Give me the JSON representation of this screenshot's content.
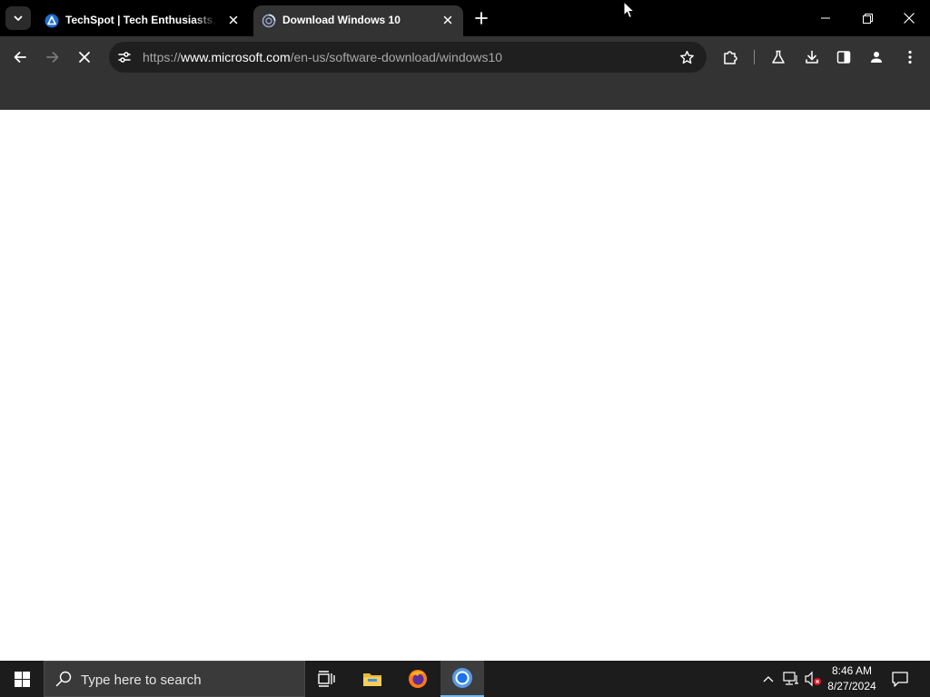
{
  "tabs": [
    {
      "title": "TechSpot | Tech Enthusiasts, Power Users",
      "favicon": "techspot-icon",
      "active": false
    },
    {
      "title": "Download Windows 10",
      "favicon": "loading-globe-icon",
      "active": true
    }
  ],
  "omnibox": {
    "scheme": "https://",
    "host": "www.microsoft.com",
    "path": "/en-us/software-download/windows10"
  },
  "taskbar": {
    "search_placeholder": "Type here to search",
    "time": "8:46 AM",
    "date": "8/27/2024"
  },
  "colors": {
    "tabstrip": "#000000",
    "toolbar": "#333333",
    "omnibox": "#1f1f1f",
    "taskbar": "#1c1c1c",
    "accent": "#76b9ed"
  }
}
